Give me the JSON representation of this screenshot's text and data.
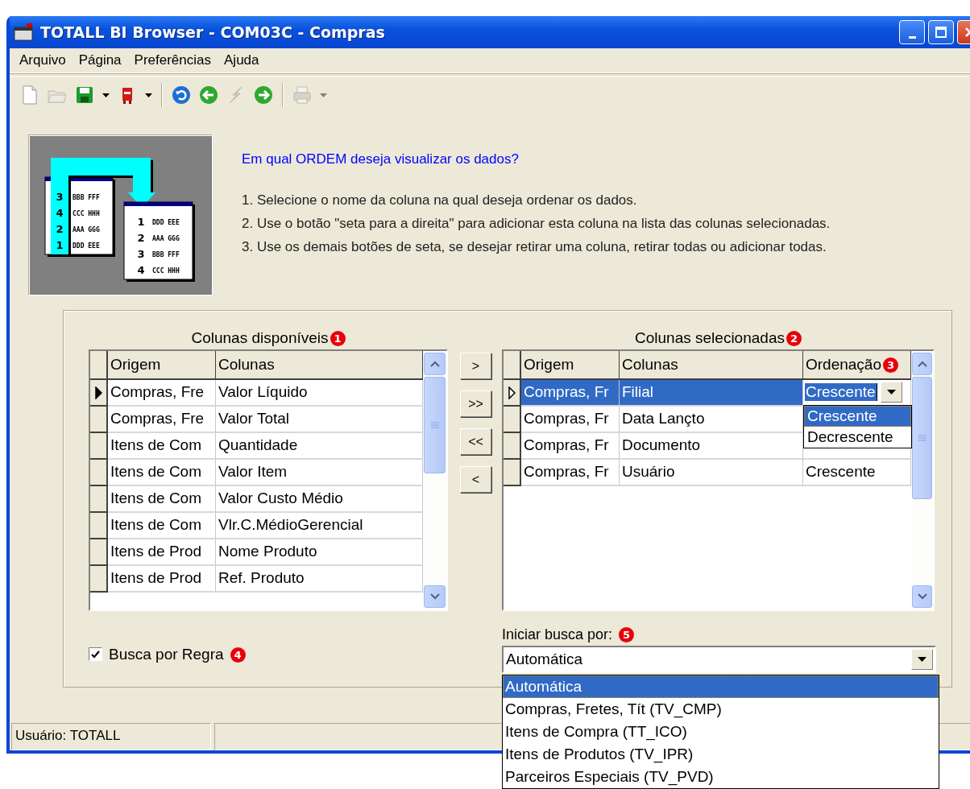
{
  "window": {
    "title": "TOTALL BI Browser - COM03C - Compras"
  },
  "menu": [
    "Arquivo",
    "Página",
    "Preferências",
    "Ajuda"
  ],
  "toolbar": [
    {
      "kind": "new",
      "disabled": false
    },
    {
      "kind": "open",
      "disabled": true
    },
    {
      "kind": "save",
      "disabled": false
    },
    {
      "kind": "caret",
      "disabled": false
    },
    {
      "kind": "mailbox",
      "disabled": false
    },
    {
      "kind": "caret",
      "disabled": false
    },
    {
      "kind": "separator"
    },
    {
      "kind": "undo",
      "disabled": false
    },
    {
      "kind": "back",
      "disabled": false
    },
    {
      "kind": "lightning",
      "disabled": true
    },
    {
      "kind": "forward",
      "disabled": false
    },
    {
      "kind": "separator"
    },
    {
      "kind": "printer",
      "disabled": true
    },
    {
      "kind": "caret",
      "disabled": true
    }
  ],
  "illustration": {
    "source_list": [
      {
        "number": "3",
        "letters": "BBB FFF"
      },
      {
        "number": "4",
        "letters": "CCC HHH"
      },
      {
        "number": "2",
        "letters": "AAA GGG"
      },
      {
        "number": "1",
        "letters": "DDD EEE"
      }
    ],
    "sorted_list": [
      {
        "number": "1",
        "letters": "DDD EEE"
      },
      {
        "number": "2",
        "letters": "AAA GGG"
      },
      {
        "number": "3",
        "letters": "BBB FFF"
      },
      {
        "number": "4",
        "letters": "CCC HHH"
      }
    ]
  },
  "prompt": {
    "heading": "Em qual ORDEM deseja visualizar os dados?",
    "steps": [
      "1. Selecione o nome da coluna na qual deseja ordenar os dados.",
      "2. Use o botão \"seta para a direita\" para adicionar esta coluna na lista das colunas selecionadas.",
      "3. Use os demais botões de seta, se desejar retirar uma coluna, retirar todas ou adicionar todas."
    ]
  },
  "available": {
    "title": "Colunas disponíveis",
    "badge": "1",
    "columns": [
      "Origem",
      "Colunas"
    ],
    "rows": [
      {
        "origem": "Compras, Fre",
        "coluna": "Valor Líquido",
        "selected": true
      },
      {
        "origem": "Compras, Fre",
        "coluna": "Valor Total",
        "selected": false
      },
      {
        "origem": "Itens de Com",
        "coluna": "Quantidade",
        "selected": false
      },
      {
        "origem": "Itens de Com",
        "coluna": "Valor Item",
        "selected": false
      },
      {
        "origem": "Itens de Com",
        "coluna": "Valor Custo Médio",
        "selected": false
      },
      {
        "origem": "Itens de Com",
        "coluna": "Vlr.C.MédioGerencial",
        "selected": false
      },
      {
        "origem": "Itens de Prod",
        "coluna": "Nome Produto",
        "selected": false
      },
      {
        "origem": "Itens de Prod",
        "coluna": "Ref. Produto",
        "selected": false
      }
    ]
  },
  "move_buttons": [
    ">",
    ">>",
    "<<",
    "<"
  ],
  "chosen": {
    "title": "Colunas selecionadas",
    "badge": "2",
    "columns": [
      "Origem",
      "Colunas",
      "Ordenação"
    ],
    "order_badge": "3",
    "rows": [
      {
        "origem": "Compras, Fr",
        "coluna": "Filial",
        "ordenacao": "Crescente",
        "selected": true
      },
      {
        "origem": "Compras, Fr",
        "coluna": "Data Lançto",
        "selected": false
      },
      {
        "origem": "Compras, Fr",
        "coluna": "Documento",
        "selected": false
      },
      {
        "origem": "Compras, Fr",
        "coluna": "Usuário",
        "ordenacao": "Crescente",
        "selected": false
      }
    ],
    "order_options": [
      {
        "label": "Crescente",
        "selected": true
      },
      {
        "label": "Decrescente",
        "selected": false
      }
    ]
  },
  "rule_search": {
    "label": "Busca por Regra",
    "checked": true,
    "badge": "4"
  },
  "start_search": {
    "label": "Iniciar busca por:",
    "badge": "5",
    "value": "Automática",
    "options": [
      {
        "label": "Automática",
        "selected": true
      },
      {
        "label": "Compras, Fretes, Tít (TV_CMP)",
        "selected": false
      },
      {
        "label": "Itens de Compra (TT_ICO)",
        "selected": false
      },
      {
        "label": "Itens de Produtos (TV_IPR)",
        "selected": false
      },
      {
        "label": "Parceiros Especiais (TV_PVD)",
        "selected": false
      }
    ]
  },
  "status_bar": {
    "panels": [
      "Usuário: TOTALL"
    ]
  }
}
